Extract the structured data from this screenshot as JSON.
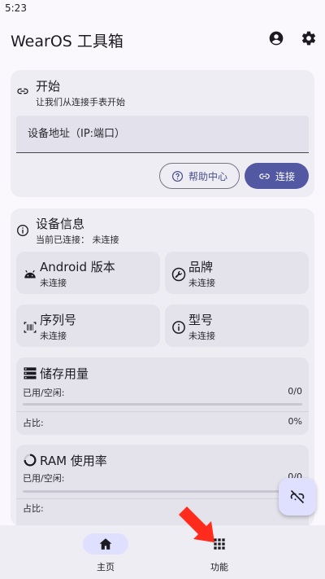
{
  "status_bar": {
    "time": "5:23"
  },
  "app_bar": {
    "title": "WearOS 工具箱",
    "account_icon": "account-circle-icon",
    "settings_icon": "gear-icon"
  },
  "connect_card": {
    "title": "开始",
    "subtitle": "让我们从连接手表开始",
    "address_placeholder": "设备地址（IP:端口）",
    "address_value": "",
    "help_label": "帮助中心",
    "connect_label": "连接"
  },
  "device_info": {
    "title": "设备信息",
    "status": "当前已连接： 未连接",
    "tiles": [
      {
        "title": "Android 版本",
        "value": "未连接",
        "icon": "android-icon"
      },
      {
        "title": "品牌",
        "value": "未连接",
        "icon": "wrench-icon"
      },
      {
        "title": "序列号",
        "value": "未连接",
        "icon": "barcode-icon"
      },
      {
        "title": "型号",
        "value": "未连接",
        "icon": "info-icon"
      }
    ],
    "storage": {
      "title": "储存用量",
      "used_free_label": "已用/空闲:",
      "used_free_value": "0/0",
      "ratio_label": "占比:",
      "ratio_value": "0%",
      "progress": 0
    },
    "ram": {
      "title": "RAM 使用率",
      "used_free_label": "已用/空闲:",
      "used_free_value": "0/0",
      "ratio_label": "占比:",
      "progress": 0
    }
  },
  "fab": {
    "icon": "link-off-icon"
  },
  "bottom_nav": {
    "items": [
      {
        "label": "主页",
        "icon": "home-icon",
        "selected": true
      },
      {
        "label": "功能",
        "icon": "apps-grid-icon",
        "selected": false
      }
    ]
  },
  "colors": {
    "primary": "#5358a2",
    "surface": "#efedf4",
    "tile": "#e4e2ea",
    "nav_indicator": "#dfe0ff",
    "arrow": "#ff2b1c"
  }
}
